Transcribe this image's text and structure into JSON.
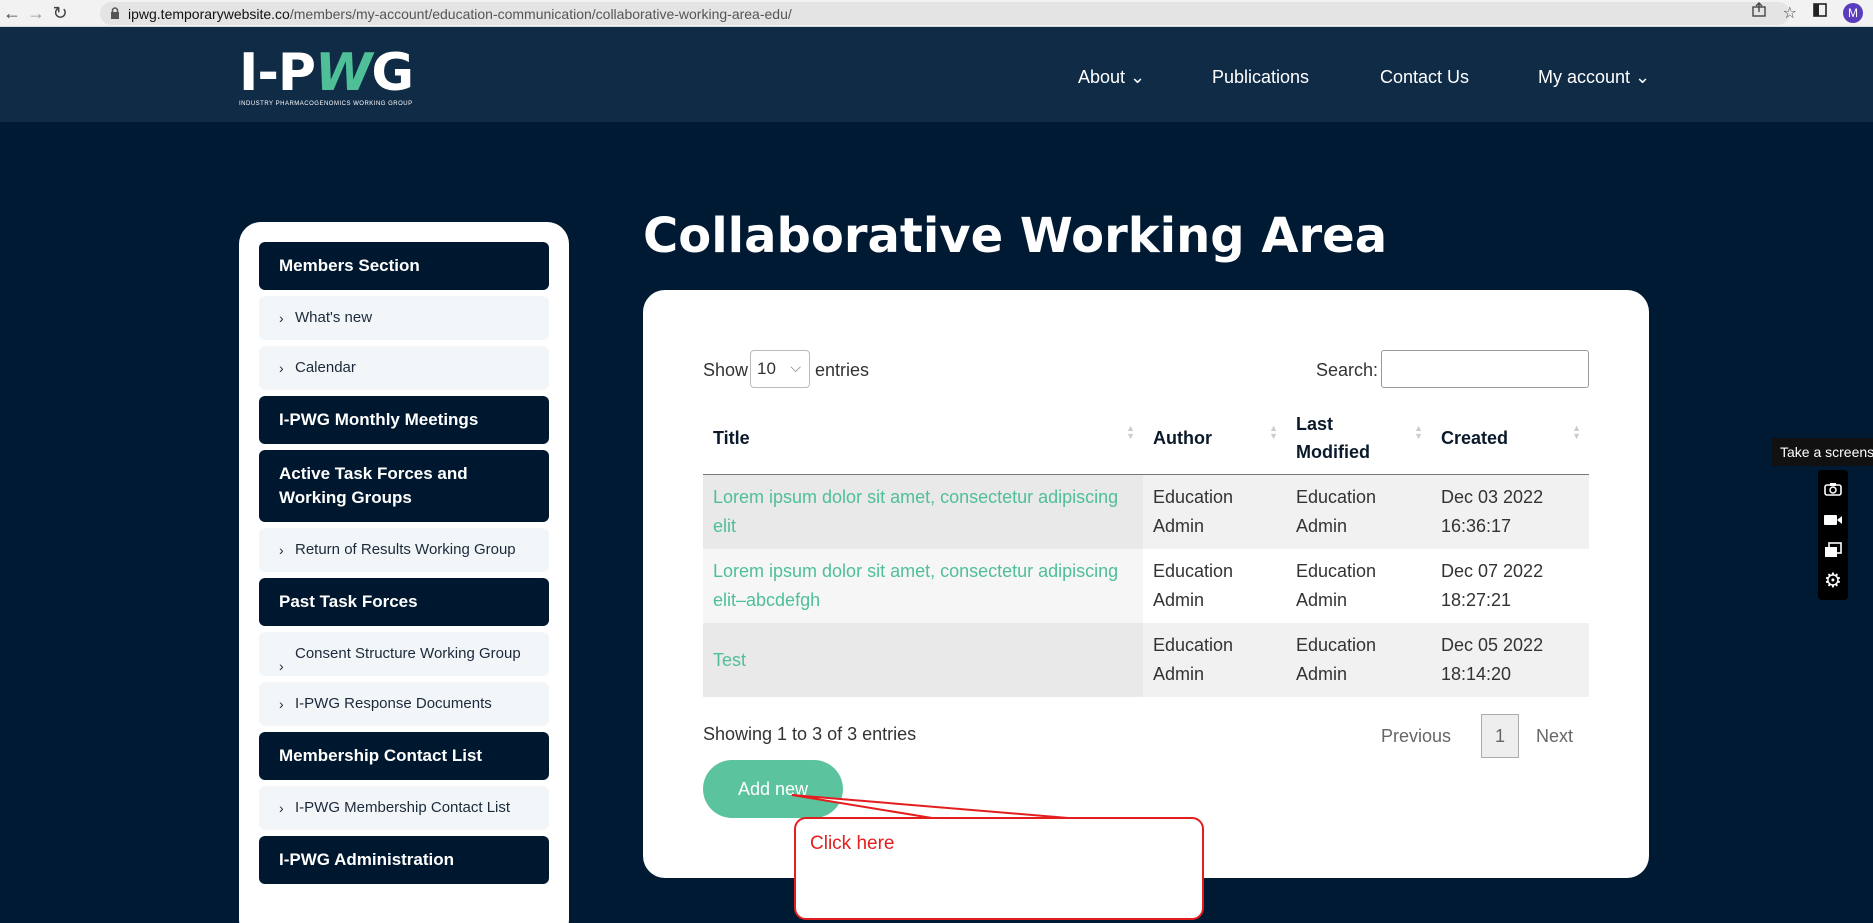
{
  "browser": {
    "url_host": "ipwg.temporarywebsite.co",
    "url_path": "/members/my-account/education-communication/collaborative-working-area-edu/",
    "avatar_letter": "M"
  },
  "header": {
    "logo_main_left": "I-P",
    "logo_main_mid": "W",
    "logo_main_right": "G",
    "logo_sub": "INDUSTRY PHARMACOGENOMICS WORKING GROUP",
    "nav": {
      "about": "About ⌄",
      "publications": "Publications",
      "contact": "Contact Us",
      "account": "My account ⌄"
    }
  },
  "sidebar": {
    "members_section": "Members Section",
    "whats_new": "What's new",
    "calendar": "Calendar",
    "monthly_meetings": "I-PWG Monthly Meetings",
    "active_task_forces": "Active Task Forces and Working Groups",
    "return_results": "Return of Results Working Group",
    "past_task_forces": "Past Task Forces",
    "consent_structure": "Consent Structure Working Group",
    "response_documents": "I-PWG Response Documents",
    "membership_contact": "Membership Contact List",
    "membership_contact_sub": "I-PWG Membership Contact List",
    "administration": "I-PWG Administration"
  },
  "main": {
    "title": "Collaborative Working Area",
    "show_label": "Show",
    "entries_value": "10",
    "entries_label": "entries",
    "search_label": "Search:",
    "columns": {
      "title": "Title",
      "author": "Author",
      "modified": "Last Modified",
      "created": "Created"
    },
    "rows": [
      {
        "title": "Lorem ipsum dolor sit amet, consectetur adipiscing elit",
        "author": "Education Admin",
        "modified": "Education Admin",
        "created": "Dec 03 2022 16:36:17"
      },
      {
        "title": "Lorem ipsum dolor sit amet, consectetur adipiscing elit–abcdefgh",
        "author": "Education Admin",
        "modified": "Education Admin",
        "created": "Dec 07 2022 18:27:21"
      },
      {
        "title": "Test",
        "author": "Education Admin",
        "modified": "Education Admin",
        "created": "Dec 05 2022 18:14:20"
      }
    ],
    "info": "Showing 1 to 3 of 3 entries",
    "prev": "Previous",
    "page": "1",
    "next": "Next",
    "add_new": "Add new"
  },
  "annotation": {
    "text": "Click here",
    "color": "#e31e1e"
  },
  "extension": {
    "tooltip": "Take a screens",
    "icons": [
      "camera-icon",
      "video-icon",
      "copy-icon",
      "gear-icon"
    ]
  },
  "colors": {
    "accent": "#4fbf98",
    "nav_bg": "#0f2b46",
    "page_bg": "#001a33",
    "side_head": "#00182f"
  }
}
